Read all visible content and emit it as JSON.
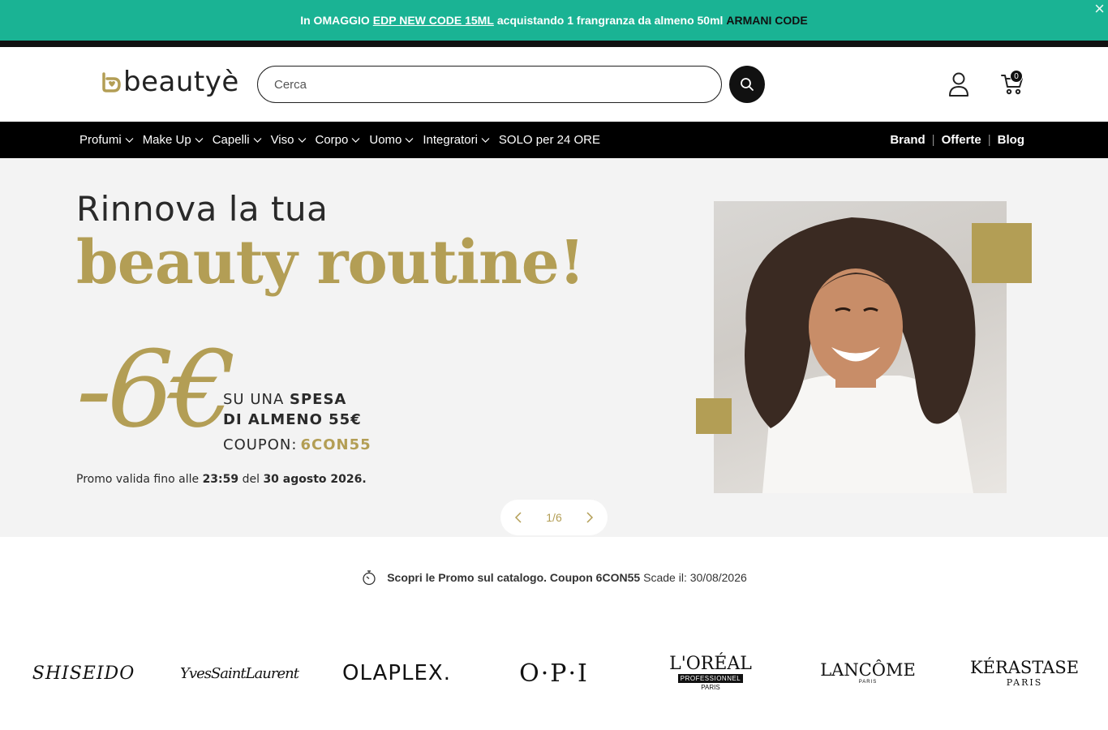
{
  "announcement": {
    "part1": "In OMAGGIO",
    "link": "EDP NEW CODE 15ML",
    "part2": "acquistando  1 frangranza da almeno 50ml",
    "brand": "ARMANI CODE",
    "close": "×"
  },
  "header": {
    "logo_text": "beautyè",
    "search_placeholder": "Cerca",
    "cart_count": "0"
  },
  "nav": {
    "items": [
      "Profumi",
      "Make Up",
      "Capelli",
      "Viso",
      "Corpo",
      "Uomo",
      "Integratori",
      "SOLO per 24 ORE"
    ],
    "right": [
      "Brand",
      "Offerte",
      "Blog"
    ],
    "separator": "|"
  },
  "hero": {
    "line1": "Rinnova la tua",
    "line2": "beauty routine!",
    "discount": "-6€",
    "offer_a": "SU UNA",
    "offer_b": "SPESA",
    "offer_line2": "DI ALMENO 55€",
    "coupon_label": "COUPON:",
    "coupon_code": "6CON55",
    "valid_a": "Promo valida fino alle",
    "valid_time": "23:59",
    "valid_b": "del",
    "valid_date": "30 agosto 2026.",
    "pager": "1/6"
  },
  "promo": {
    "bold": "Scopri le Promo sul catalogo. Coupon 6CON55",
    "rest": "Scade il: 30/08/2026"
  },
  "brands": {
    "shiseido": "SHISEIDO",
    "ysl": "YvesSaintLaurent",
    "olaplex": "OLAPLEX.",
    "opi": "O·P·I",
    "loreal": "L'ORÉAL",
    "loreal_sub": "PROFESSIONNEL",
    "loreal_city": "PARIS",
    "lancome": "LANCÔME",
    "lancome_city": "PARIS",
    "kerastase": "KÉRASTASE",
    "kerastase_city": "PARIS"
  },
  "colors": {
    "announcement_bg": "#1ab394",
    "accent_gold": "#b39e55",
    "nav_bg": "#000000"
  }
}
